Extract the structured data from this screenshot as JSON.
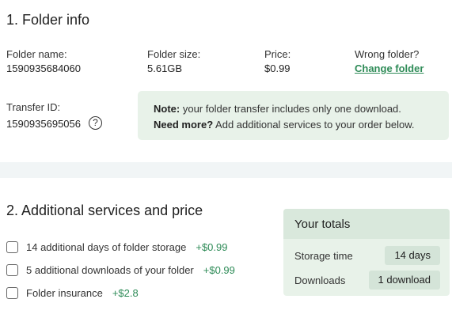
{
  "folder_info": {
    "heading": "1. Folder info",
    "folder_name_label": "Folder name:",
    "folder_name": "1590935684060",
    "folder_size_label": "Folder size:",
    "folder_size": "5.61GB",
    "price_label": "Price:",
    "price": "$0.99",
    "wrong_folder_label": "Wrong folder?",
    "change_folder_link": "Change folder",
    "transfer_id_label": "Transfer ID:",
    "transfer_id": "1590935695056",
    "help_icon": "?",
    "note": {
      "line1_bold": "Note:",
      "line1_text": "your folder transfer includes only one download.",
      "line2_bold": "Need more?",
      "line2_text": "Add additional services to your order below."
    }
  },
  "services": {
    "heading": "2. Additional services and price",
    "options": [
      {
        "label": "14 additional days of folder storage",
        "price": "+$0.99"
      },
      {
        "label": "5 additional downloads of your folder",
        "price": "+$0.99"
      },
      {
        "label": "Folder insurance",
        "price": "+$2.8"
      }
    ]
  },
  "totals": {
    "heading": "Your totals",
    "rows": [
      {
        "label": "Storage time",
        "value": "14 days"
      },
      {
        "label": "Downloads",
        "value": "1 download"
      }
    ]
  },
  "colors": {
    "accent_green": "#2e8b57",
    "note_bg": "#e8f2e9",
    "divider_bg": "#f1f5f6"
  }
}
